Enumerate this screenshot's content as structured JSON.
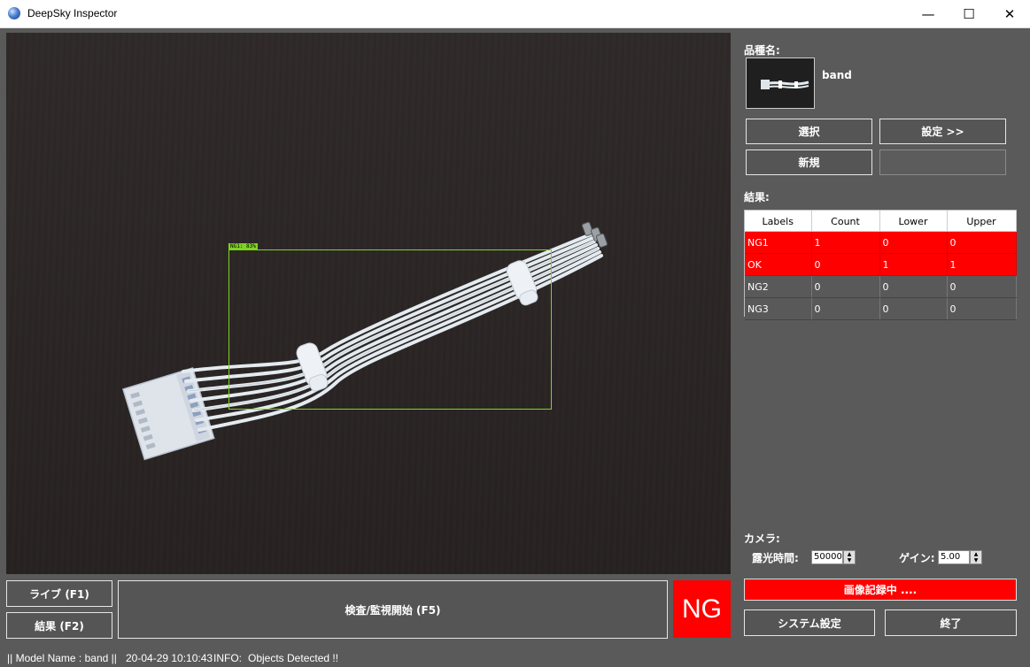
{
  "window": {
    "title": "DeepSky Inspector",
    "minimize": "—",
    "maximize": "☐",
    "close": "✕"
  },
  "detection": {
    "label": "NG1: 83%",
    "box_color": "#7ed321"
  },
  "product": {
    "section_label": "品種名:",
    "name": "band"
  },
  "buttons": {
    "select": "選択",
    "settings": "設定 >>",
    "new": "新規",
    "blank": "",
    "live": "ライブ (F1)",
    "result": "結果 (F2)",
    "start": "検査/監視開始 (F5)",
    "system_settings": "システム設定",
    "exit": "終了"
  },
  "results": {
    "section_label": "結果:",
    "columns": [
      "Labels",
      "Count",
      "Lower",
      "Upper"
    ],
    "rows": [
      {
        "label": "NG1",
        "count": "1",
        "lower": "0",
        "upper": "0",
        "highlight": true
      },
      {
        "label": "OK",
        "count": "0",
        "lower": "1",
        "upper": "1",
        "highlight": true
      },
      {
        "label": "NG2",
        "count": "0",
        "lower": "0",
        "upper": "0",
        "highlight": false
      },
      {
        "label": "NG3",
        "count": "0",
        "lower": "0",
        "upper": "0",
        "highlight": false
      }
    ]
  },
  "camera": {
    "section_label": "カメラ:",
    "exposure_label": "露光時間:",
    "exposure_value": "50000",
    "gain_label": "ゲイン:",
    "gain_value": "5.00"
  },
  "recording": {
    "text": "画像記録中 ...."
  },
  "verdict": {
    "text": "NG",
    "color": "#ff0000"
  },
  "status": {
    "model": "|| Model Name : band ||",
    "timestamp": "20-04-29 10:10:43",
    "info_label": "INFO:",
    "message": "Objects Detected !!"
  }
}
